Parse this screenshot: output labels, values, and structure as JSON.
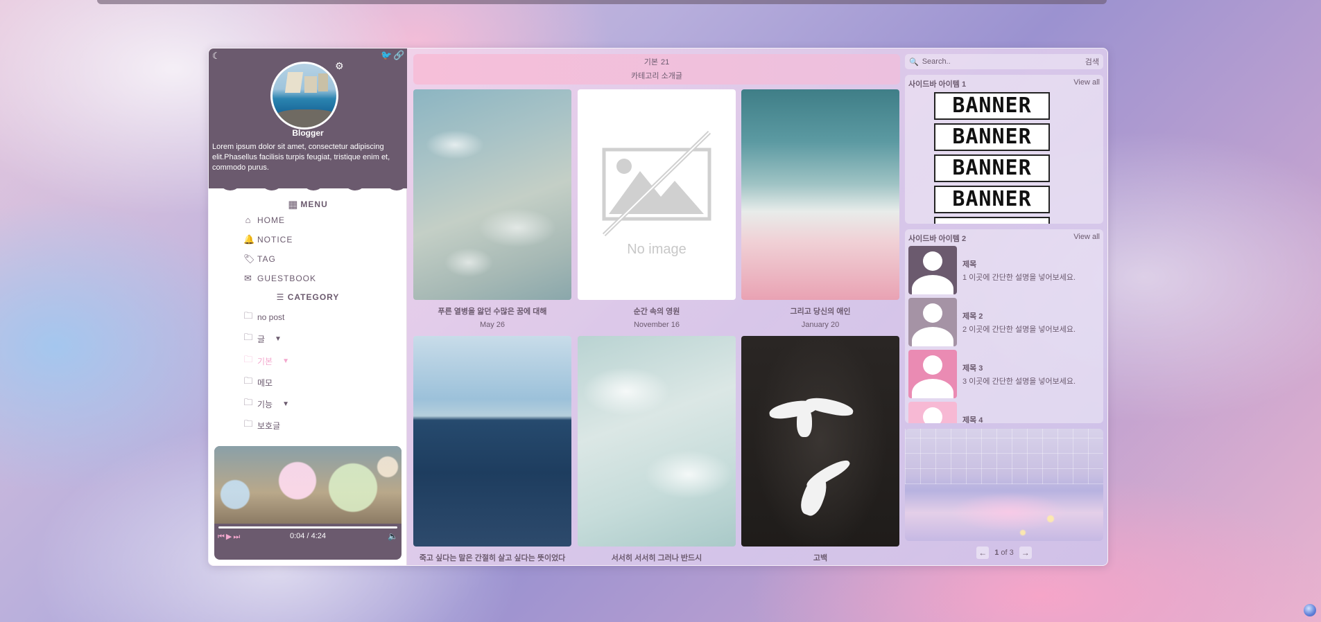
{
  "profile": {
    "name": "Blogger",
    "bio": "Lorem ipsum dolor sit amet, consectetur adipiscing elit.Phasellus facilisis turpis feugiat, tristique enim et, commodo purus."
  },
  "menu": {
    "title": "MENU",
    "items": [
      {
        "label": "HOME",
        "icon": "home-icon"
      },
      {
        "label": "NOTICE",
        "icon": "bell-icon"
      },
      {
        "label": "TAG",
        "icon": "tag-icon"
      },
      {
        "label": "GUESTBOOK",
        "icon": "mail-icon"
      }
    ]
  },
  "category": {
    "title": "CATEGORY",
    "items": [
      {
        "label": "no post"
      },
      {
        "label": "글"
      },
      {
        "label": "기본"
      },
      {
        "label": "메모"
      },
      {
        "label": "기능"
      },
      {
        "label": "보호글"
      }
    ]
  },
  "player": {
    "time": "0:04 / 4:24",
    "progress": 0.015
  },
  "header": {
    "category": "기본",
    "count": "21",
    "description": "카테고리 소개글"
  },
  "posts": [
    {
      "title": "푸른 열병을 앓던 수많은 꿈에 대해",
      "date": "May 26"
    },
    {
      "title": "순간 속의 영원",
      "date": "November 16",
      "placeholder": "No image"
    },
    {
      "title": "그리고 당신의 애인",
      "date": "January 20"
    },
    {
      "title": "죽고 싶다는 말은 간절히 살고 싶다는 뜻이었다",
      "date": ""
    },
    {
      "title": "서서히 서서히 그러나 반드시",
      "date": ""
    },
    {
      "title": "고백",
      "date": ""
    }
  ],
  "search": {
    "placeholder": "Search..",
    "button": "검색"
  },
  "sidebar1": {
    "title": "사이드바 아이템 1",
    "view_all": "View all",
    "banners": [
      "BANNER",
      "BANNER",
      "BANNER",
      "BANNER"
    ]
  },
  "sidebar2": {
    "title": "사이드바 아이템 2",
    "view_all": "View all",
    "items": [
      {
        "title": "제목",
        "desc": "1 이곳에 간단한 설명을 넣어보세요.",
        "color": "#6b5a6e"
      },
      {
        "title": "제목 2",
        "desc": "2 이곳에 간단한 설명을 넣어보세요.",
        "color": "#a593a5"
      },
      {
        "title": "제목 3",
        "desc": "3 이곳에 간단한 설명을 넣어보세요.",
        "color": "#ea8bb3"
      },
      {
        "title": "제목 4",
        "desc": "",
        "color": "#f7b9d4"
      }
    ]
  },
  "pager": {
    "current": "1",
    "of_label": "of 3"
  }
}
